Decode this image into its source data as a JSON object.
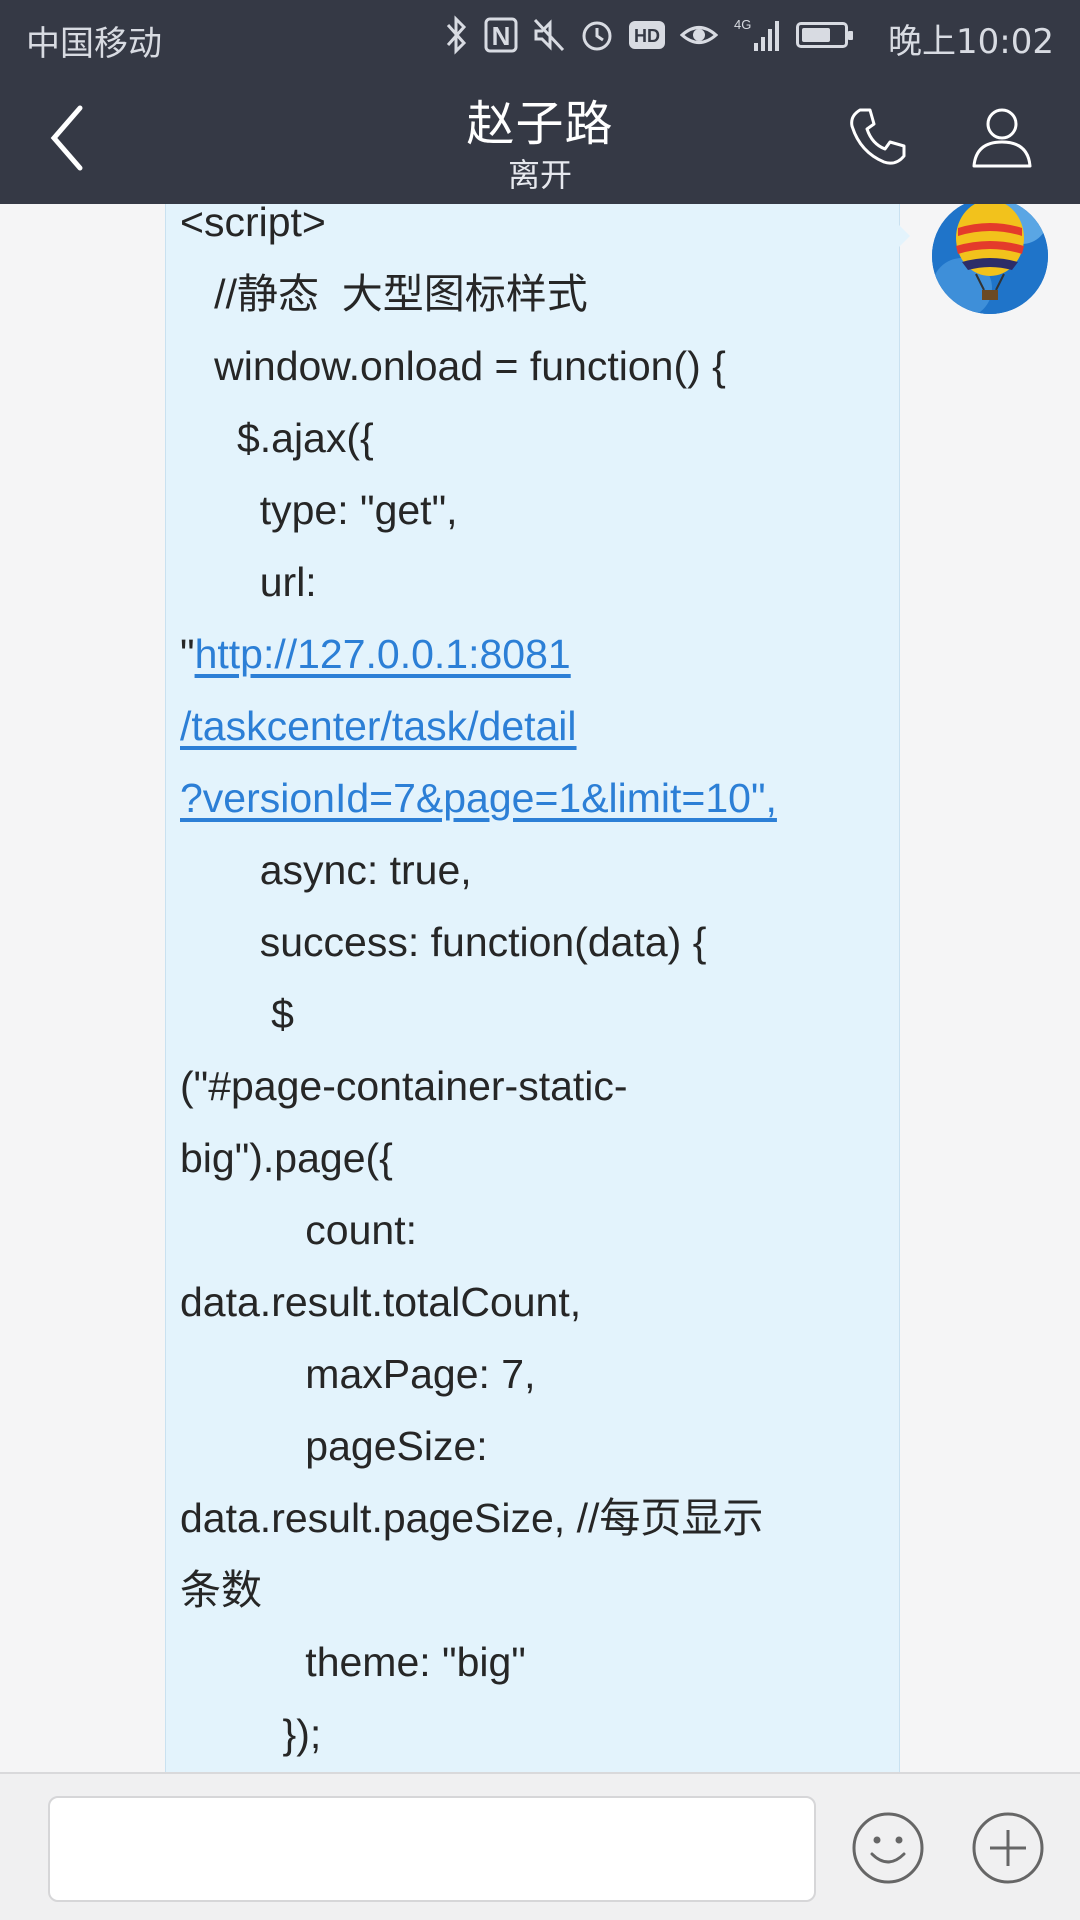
{
  "status_bar": {
    "carrier": "中国移动",
    "network": "4G",
    "hd_badge": "HD",
    "nfc_letter": "N",
    "time": "晚上10:02",
    "icons": [
      "bluetooth-icon",
      "nfc-icon",
      "mute-icon",
      "alarm-icon",
      "hd-icon",
      "eye-icon",
      "signal-icon",
      "battery-icon"
    ]
  },
  "header": {
    "title": "赵子路",
    "subtitle": "离开",
    "icons": [
      "back-icon",
      "phone-icon",
      "user-icon"
    ]
  },
  "message": {
    "lines": [
      "<script>",
      "   //静态  大型图标样式",
      "   window.onload = function() {",
      "     $.ajax({",
      "       type: \"get\",",
      "       url:",
      "\"",
      "http://127.0.0.1:8081",
      "/taskcenter/task/detail",
      "?versionId=7&page=1&limit=10\",",
      "       async: true,",
      "       success: function(data) {",
      "        $",
      "(\"#page-container-static-",
      "big\").page({",
      "           count:",
      "data.result.totalCount,",
      "           maxPage: 7,",
      "           pageSize:",
      "data.result.pageSize, //每页显示",
      "条数",
      "           theme: \"big\"",
      "         });"
    ]
  },
  "input": {
    "value": "",
    "placeholder": ""
  },
  "colors": {
    "header_bg": "#353945",
    "bubble_bg": "#e3f3fc",
    "link": "#2c7fd6",
    "chat_bg": "#f5f5f6"
  }
}
